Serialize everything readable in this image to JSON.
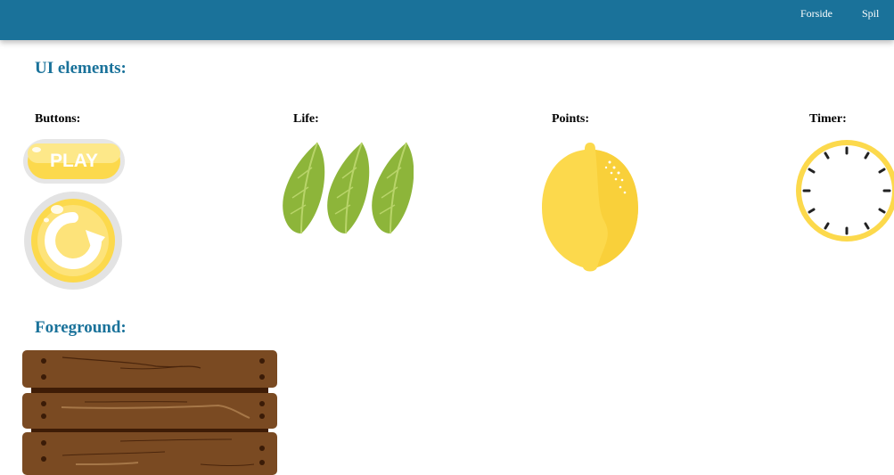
{
  "nav": {
    "links": [
      {
        "label": "Forside"
      },
      {
        "label": "Spil"
      }
    ]
  },
  "sections": {
    "ui_elements": {
      "title": "UI elements:",
      "columns": {
        "buttons": "Buttons:",
        "life": "Life:",
        "points": "Points:",
        "timer": "Timer:"
      },
      "play_button_label": "PLAY"
    },
    "foreground": {
      "title": "Foreground:"
    }
  },
  "colors": {
    "header": "#1a729a",
    "accent_yellow": "#fcd94c",
    "leaf_green": "#8db53a",
    "crate_brown": "#7a4a22"
  }
}
